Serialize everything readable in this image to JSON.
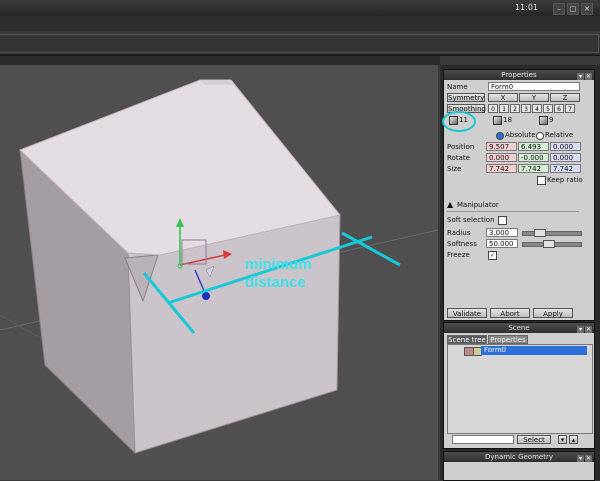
{
  "window": {
    "clock": "11:01",
    "controls": [
      "–",
      "□",
      "✕"
    ]
  },
  "annotation": {
    "line1": "minimum",
    "line2": "distance",
    "color": "#3ee0e8"
  },
  "properties": {
    "title": "Properties",
    "name_label": "Name",
    "name_value": "Form0",
    "symmetry_label": "Symmetry",
    "axes": [
      "X",
      "Y",
      "Z"
    ],
    "smoothing_label": "Smoothing",
    "smoothing_levels": [
      "0",
      "1",
      "2",
      "3",
      "4",
      "5",
      "6",
      "7"
    ],
    "counts": [
      "11",
      "18",
      "9"
    ],
    "absolute_label": "Absolute",
    "relative_label": "Relative",
    "position_label": "Position",
    "position": [
      "9.507",
      "6.493",
      "0.000"
    ],
    "rotate_label": "Rotate",
    "rotate": [
      "0.000",
      "-0.000",
      "0.000"
    ],
    "size_label": "Size",
    "size": [
      "7.742",
      "7.742",
      "7.742"
    ],
    "keep_ratio_label": "Keep ratio",
    "manipulator_label": "Manipulator",
    "soft_selection_label": "Soft selection",
    "radius_label": "Radius",
    "radius_value": "3.000",
    "softness_label": "Softness",
    "softness_value": "50.000",
    "freeze_label": "Freeze",
    "validate_label": "Validate",
    "abort_label": "Abort",
    "apply_label": "Apply"
  },
  "scene": {
    "title": "Scene",
    "tabs": [
      "Scene tree",
      "Properties"
    ],
    "item": "Form0",
    "select_label": "Select"
  },
  "dynamic_geometry": {
    "title": "Dynamic Geometry"
  },
  "colors": {
    "cube_light": "#e4dde3",
    "cube_mid": "#c9c2c8",
    "cube_dark": "#a59ea5",
    "viewport_bg": "#4f4f4f",
    "highlight": "#19c8d6",
    "selection_blue": "#2d6fd6"
  }
}
